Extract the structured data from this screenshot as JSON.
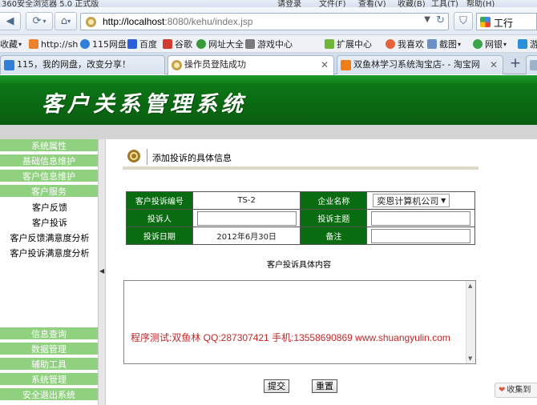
{
  "browser": {
    "titlebar": {
      "app_title": "360安全浏览器 5.0 正式版",
      "account": "请登录",
      "menu": [
        "文件(F)",
        "查看(V)",
        "收藏(B)",
        "工具(T)",
        "帮助(H)"
      ]
    },
    "url": {
      "host": "http://localhost",
      "rest": ":8080/kehu/index.jsp"
    },
    "search_engine": "工行",
    "bookmarks": [
      {
        "label": "收藏"
      },
      {
        "label": "http://sh"
      },
      {
        "label": "115网盘"
      },
      {
        "label": "百度"
      },
      {
        "label": "谷歌"
      },
      {
        "label": "网址大全"
      },
      {
        "label": "游戏中心"
      },
      {
        "label": "扩展中心"
      },
      {
        "label": "我喜欢"
      },
      {
        "label": "截图"
      },
      {
        "label": "网银"
      },
      {
        "label": "游"
      }
    ],
    "tabs": [
      {
        "label": "115，我的网盘，改变分享！"
      },
      {
        "label": "操作员登陆成功"
      },
      {
        "label": "双鱼林学习系统淘宝店- - 淘宝网"
      }
    ]
  },
  "page": {
    "banner_title": "客户关系管理系统",
    "sidebar": {
      "top_categories": [
        "系统属性",
        "基础信息维护",
        "客户信息维护",
        "客户服务"
      ],
      "items": [
        "客户反馈",
        "客户投诉",
        "客户反馈满意度分析",
        "客户投诉满意度分析"
      ],
      "bottom_categories": [
        "信息查询",
        "数据管理",
        "辅助工具",
        "系统管理",
        "安全退出系统"
      ]
    },
    "section_title": "添加投诉的具体信息",
    "form": {
      "complaint_id_label": "客户投诉编号",
      "complaint_id_value": "TS-2",
      "company_label": "企业名称",
      "company_value": "奕恩计算机公司",
      "complainant_label": "投诉人",
      "complainant_value": "",
      "subject_label": "投诉主题",
      "subject_value": "",
      "date_label": "投诉日期",
      "date_value": "2012年6月30日",
      "remark_label": "备注",
      "remark_value": ""
    },
    "content_label": "客户投诉具体内容",
    "content_text": "程序测试:双鱼林 QQ:287307421 手机:13558690869 www.shuangyulin.com",
    "submit_label": "提交",
    "reset_label": "重置"
  },
  "overlay": {
    "favorite_label": "收集到"
  },
  "colors": {
    "banner_green": "#0a6a12",
    "label_green": "#0a6c10",
    "sidebar_green": "#8fd17f",
    "content_red": "#c0282a"
  }
}
